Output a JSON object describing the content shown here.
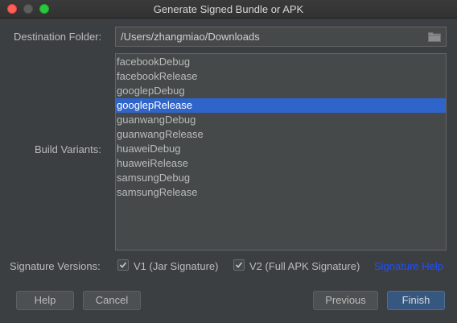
{
  "window": {
    "title": "Generate Signed Bundle or APK"
  },
  "destination": {
    "label": "Destination Folder:",
    "value": "/Users/zhangmiao/Downloads",
    "icon": "folder-icon"
  },
  "build_variants": {
    "label": "Build Variants:",
    "items": [
      "facebookDebug",
      "facebookRelease",
      "googlepDebug",
      "googlepRelease",
      "guanwangDebug",
      "guanwangRelease",
      "huaweiDebug",
      "huaweiRelease",
      "samsungDebug",
      "samsungRelease"
    ],
    "selected": "googlepRelease"
  },
  "signature": {
    "label": "Signature Versions:",
    "v1_label": "V1 (Jar Signature)",
    "v1_checked": true,
    "v2_label": "V2 (Full APK Signature)",
    "v2_checked": true,
    "help_link": "Signature Help"
  },
  "buttons": {
    "help": "Help",
    "cancel": "Cancel",
    "previous": "Previous",
    "finish": "Finish"
  },
  "colors": {
    "background": "#3c3f41",
    "selection": "#2f65ca",
    "link": "#1f4fff",
    "primary_button": "#365880"
  }
}
